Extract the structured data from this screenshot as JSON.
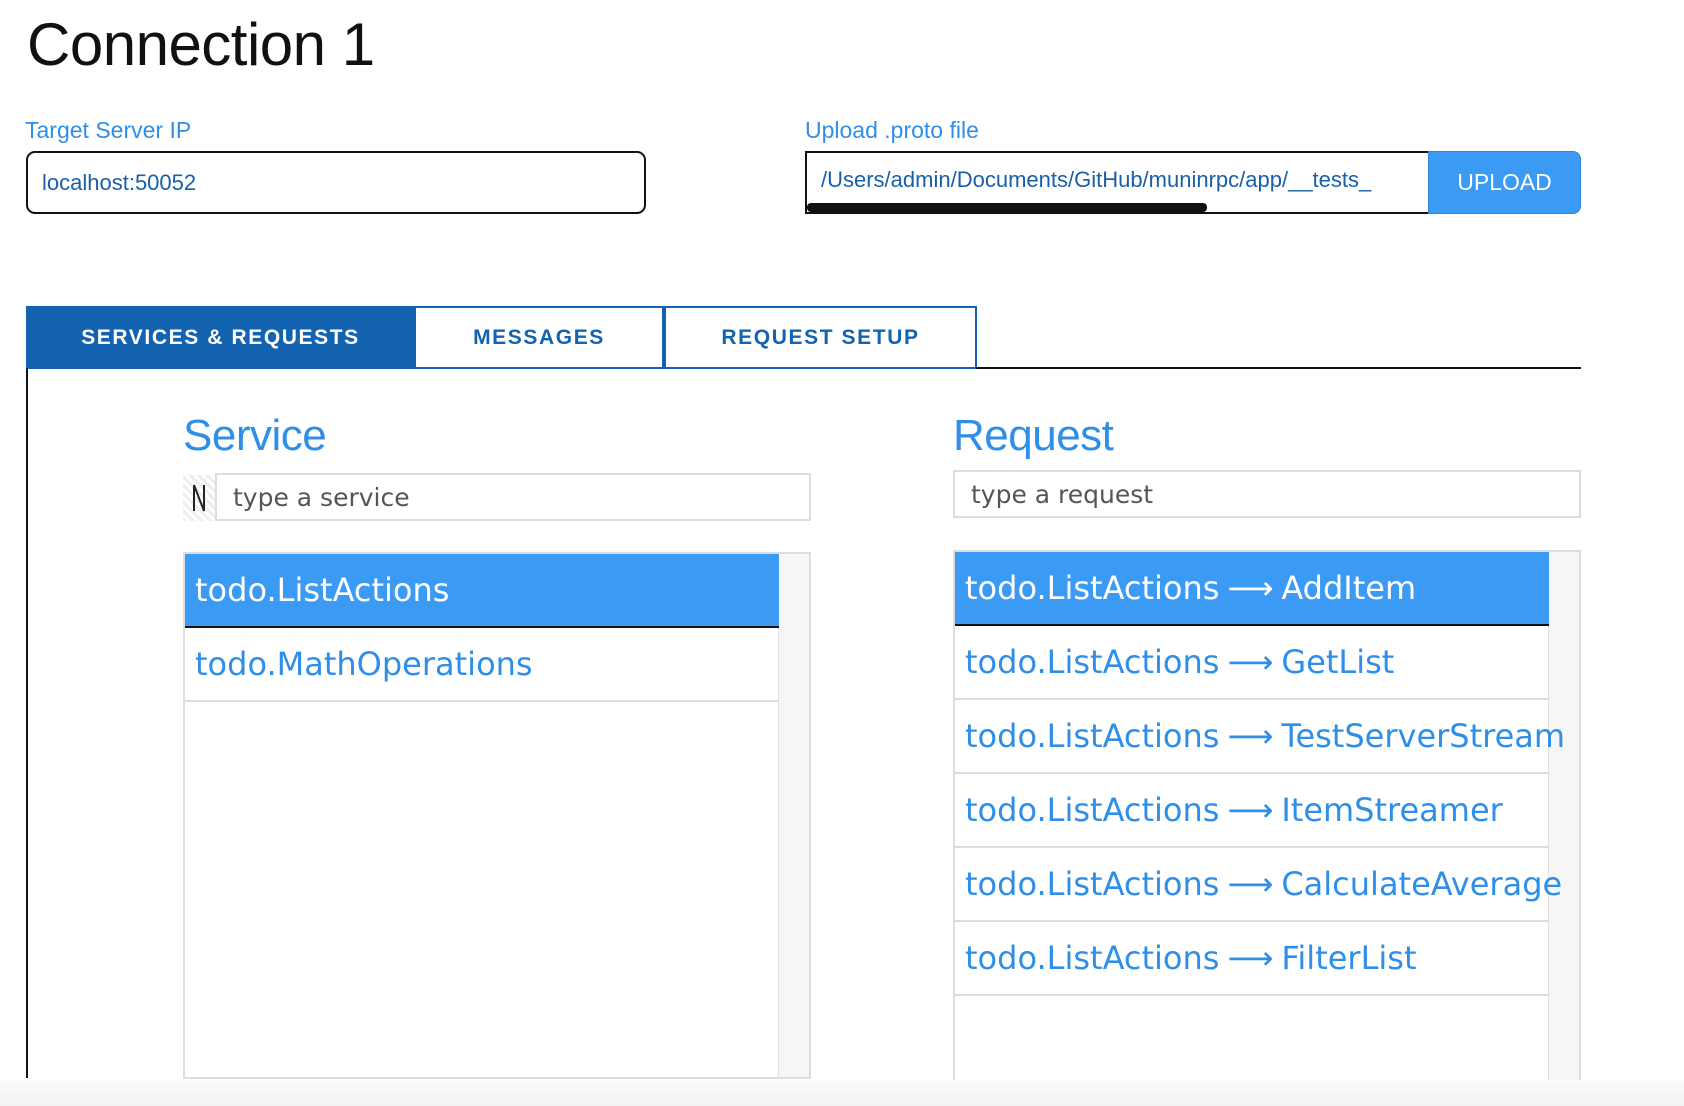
{
  "title": "Connection 1",
  "target_server": {
    "label": "Target Server IP",
    "value": "localhost:50052"
  },
  "proto_upload": {
    "label": "Upload .proto file",
    "path": "/Users/admin/Documents/GitHub/muninrpc/app/__tests_",
    "button_label": "UPLOAD"
  },
  "tabs": [
    {
      "label": "SERVICES & REQUESTS",
      "active": true
    },
    {
      "label": "MESSAGES",
      "active": false
    },
    {
      "label": "REQUEST SETUP",
      "active": false
    }
  ],
  "service": {
    "title": "Service",
    "placeholder": "type a service",
    "filter_icon": "filter-icon",
    "items": [
      {
        "label": "todo.ListActions",
        "selected": true
      },
      {
        "label": "todo.MathOperations",
        "selected": false
      }
    ]
  },
  "request": {
    "title": "Request",
    "placeholder": "type a request",
    "arrow": "⟶",
    "items": [
      {
        "service": "todo.ListActions",
        "method": "AddItem",
        "selected": true
      },
      {
        "service": "todo.ListActions",
        "method": "GetList",
        "selected": false
      },
      {
        "service": "todo.ListActions",
        "method": "TestServerStream",
        "selected": false
      },
      {
        "service": "todo.ListActions",
        "method": "ItemStreamer",
        "selected": false
      },
      {
        "service": "todo.ListActions",
        "method": "CalculateAverage",
        "selected": false
      },
      {
        "service": "todo.ListActions",
        "method": "FilterList",
        "selected": false
      }
    ]
  },
  "colors": {
    "accent": "#3a9af4",
    "tab_active": "#1363b0",
    "link_text": "#2f8fe8"
  }
}
